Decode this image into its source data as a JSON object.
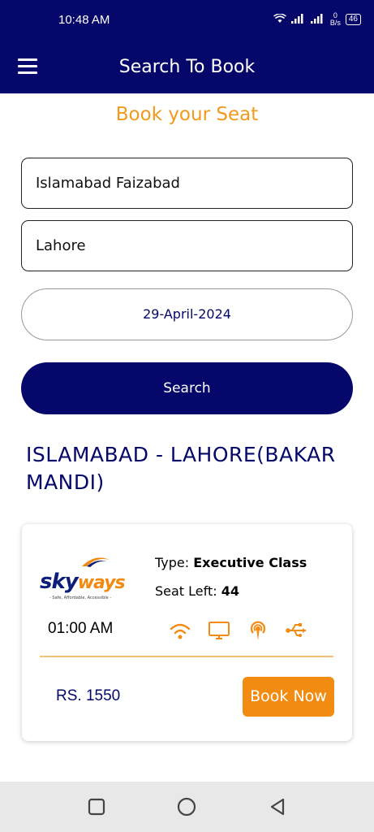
{
  "status_bar": {
    "time": "10:48 AM",
    "net_speed_value": "0",
    "net_speed_unit": "B/s",
    "battery": "46",
    "icons": [
      "wifi-icon",
      "signal-icon",
      "signal-icon",
      "battery-icon"
    ]
  },
  "app_bar": {
    "title": "Search To Book",
    "menu_icon": "hamburger-menu-icon"
  },
  "form": {
    "heading": "Book your Seat",
    "from_value": "Islamabad Faizabad",
    "to_value": "Lahore",
    "date_value": "29-April-2024",
    "search_label": "Search"
  },
  "results": {
    "route_title": "ISLAMABAD - LAHORE(BAKAR MANDI)",
    "trips": [
      {
        "operator_logo_sky": "sky",
        "operator_logo_ways": "ways",
        "operator_tagline": "- Safe, Affordable, Accessible -",
        "type_label": "Type:",
        "type_value": "Executive Class",
        "seat_left_label": "Seat Left:",
        "seat_left_value": "44",
        "departure_time": "01:00 AM",
        "amenities": [
          "wifi-icon",
          "tv-icon",
          "audio-icon",
          "usb-icon"
        ],
        "price": "RS. 1550",
        "book_label": "Book Now"
      }
    ]
  },
  "nav_bar": {
    "items": [
      "recent-apps-icon",
      "home-icon",
      "back-icon"
    ]
  },
  "colors": {
    "primary": "#05086a",
    "accent": "#f28b12",
    "divider": "#f5c07a"
  }
}
